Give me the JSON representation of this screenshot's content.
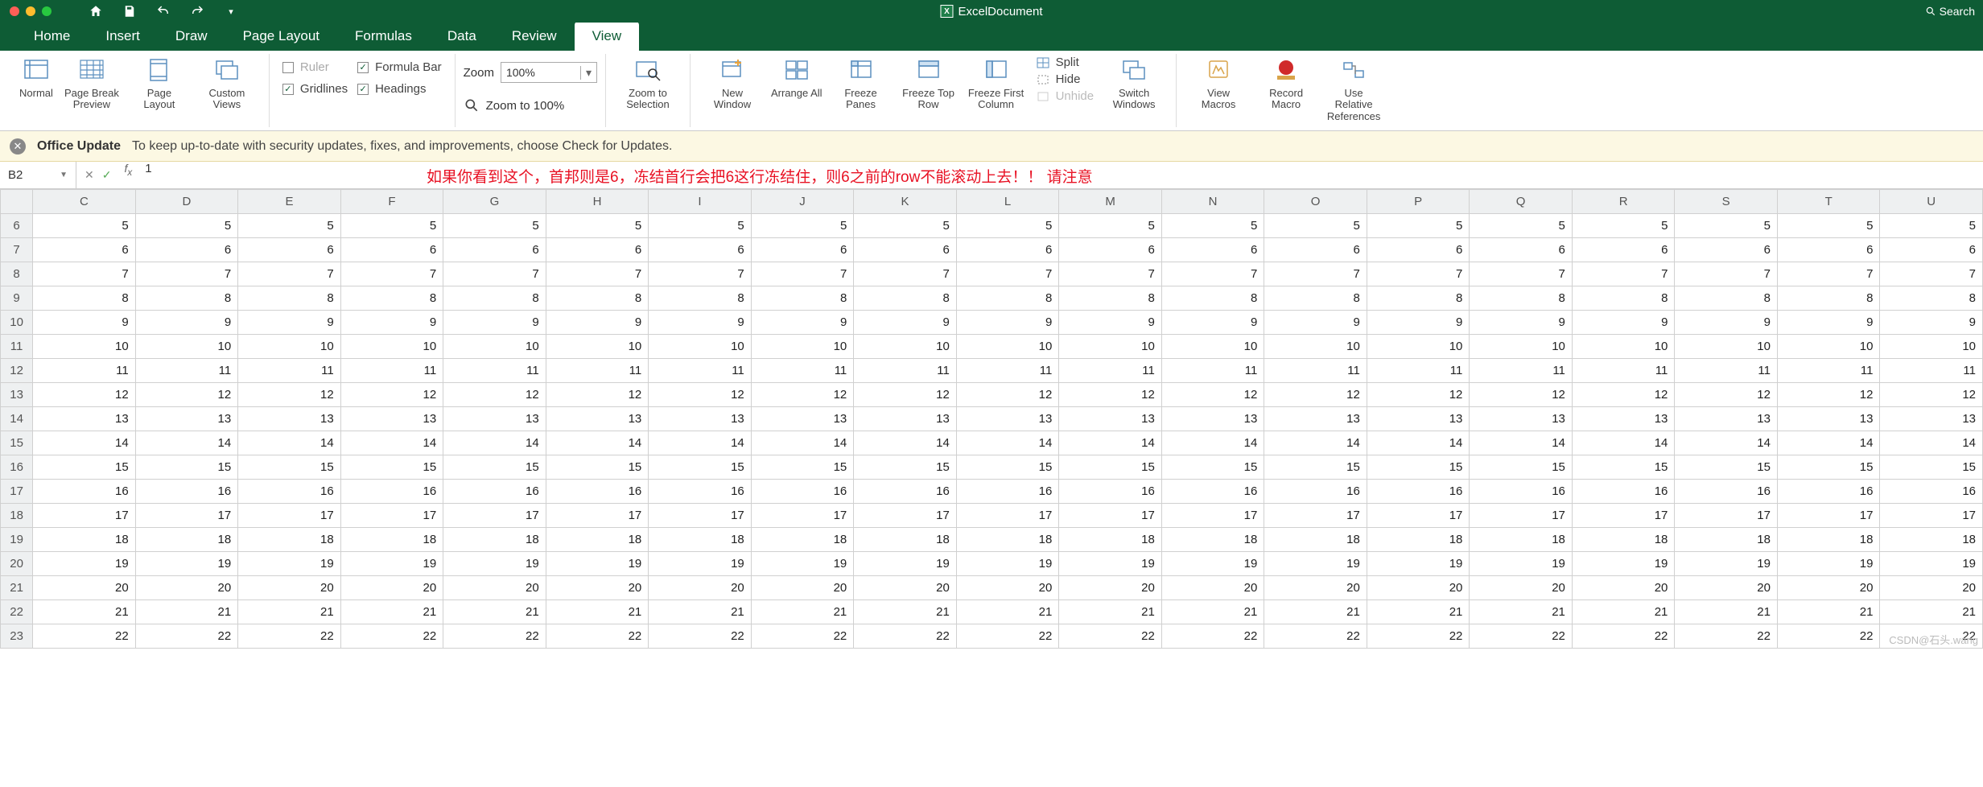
{
  "title": "ExcelDocument",
  "search_placeholder": "Search",
  "tabs": [
    "Home",
    "Insert",
    "Draw",
    "Page Layout",
    "Formulas",
    "Data",
    "Review",
    "View"
  ],
  "active_tab": "View",
  "ribbon": {
    "views": {
      "normal": "Normal",
      "page_break": "Page Break Preview",
      "page_layout": "Page Layout",
      "custom": "Custom Views"
    },
    "show": {
      "ruler": "Ruler",
      "formula_bar": "Formula Bar",
      "gridlines": "Gridlines",
      "headings": "Headings",
      "ruler_checked": false,
      "formula_checked": true,
      "gridlines_checked": true,
      "headings_checked": true
    },
    "zoom": {
      "label": "Zoom",
      "value": "100%",
      "to100": "Zoom to 100%",
      "to_selection": "Zoom to Selection"
    },
    "window": {
      "new": "New Window",
      "arrange": "Arrange All",
      "freeze": "Freeze Panes",
      "freeze_top": "Freeze Top Row",
      "freeze_first": "Freeze First Column",
      "split": "Split",
      "hide": "Hide",
      "unhide": "Unhide",
      "switch": "Switch Windows"
    },
    "macros": {
      "view": "View Macros",
      "record": "Record Macro",
      "relref": "Use Relative References"
    }
  },
  "message": {
    "title": "Office Update",
    "body": "To keep up-to-date with security updates, fixes, and improvements, choose Check for Updates."
  },
  "cell_ref": "B2",
  "formula_value": "1",
  "overlay": "如果你看到这个，首邦则是6，冻结首行会把6这行冻结住，则6之前的row不能滚动上去！！ 请注意",
  "columns": [
    "C",
    "D",
    "E",
    "F",
    "G",
    "H",
    "I",
    "J",
    "K",
    "L",
    "M",
    "N",
    "O",
    "P",
    "Q",
    "R",
    "S",
    "T",
    "U"
  ],
  "rows": [
    6,
    7,
    8,
    9,
    10,
    11,
    12,
    13,
    14,
    15,
    16,
    17,
    18,
    19,
    20,
    21,
    22,
    23
  ],
  "row_value_map": {
    "6": 5,
    "7": 6,
    "8": 7,
    "9": 8,
    "10": 9,
    "11": 10,
    "12": 11,
    "13": 12,
    "14": 13,
    "15": 14,
    "16": 15,
    "17": 16,
    "18": 17,
    "19": 18,
    "20": 19,
    "21": 20,
    "22": 21,
    "23": 22
  },
  "watermark": "CSDN@石头.wang"
}
